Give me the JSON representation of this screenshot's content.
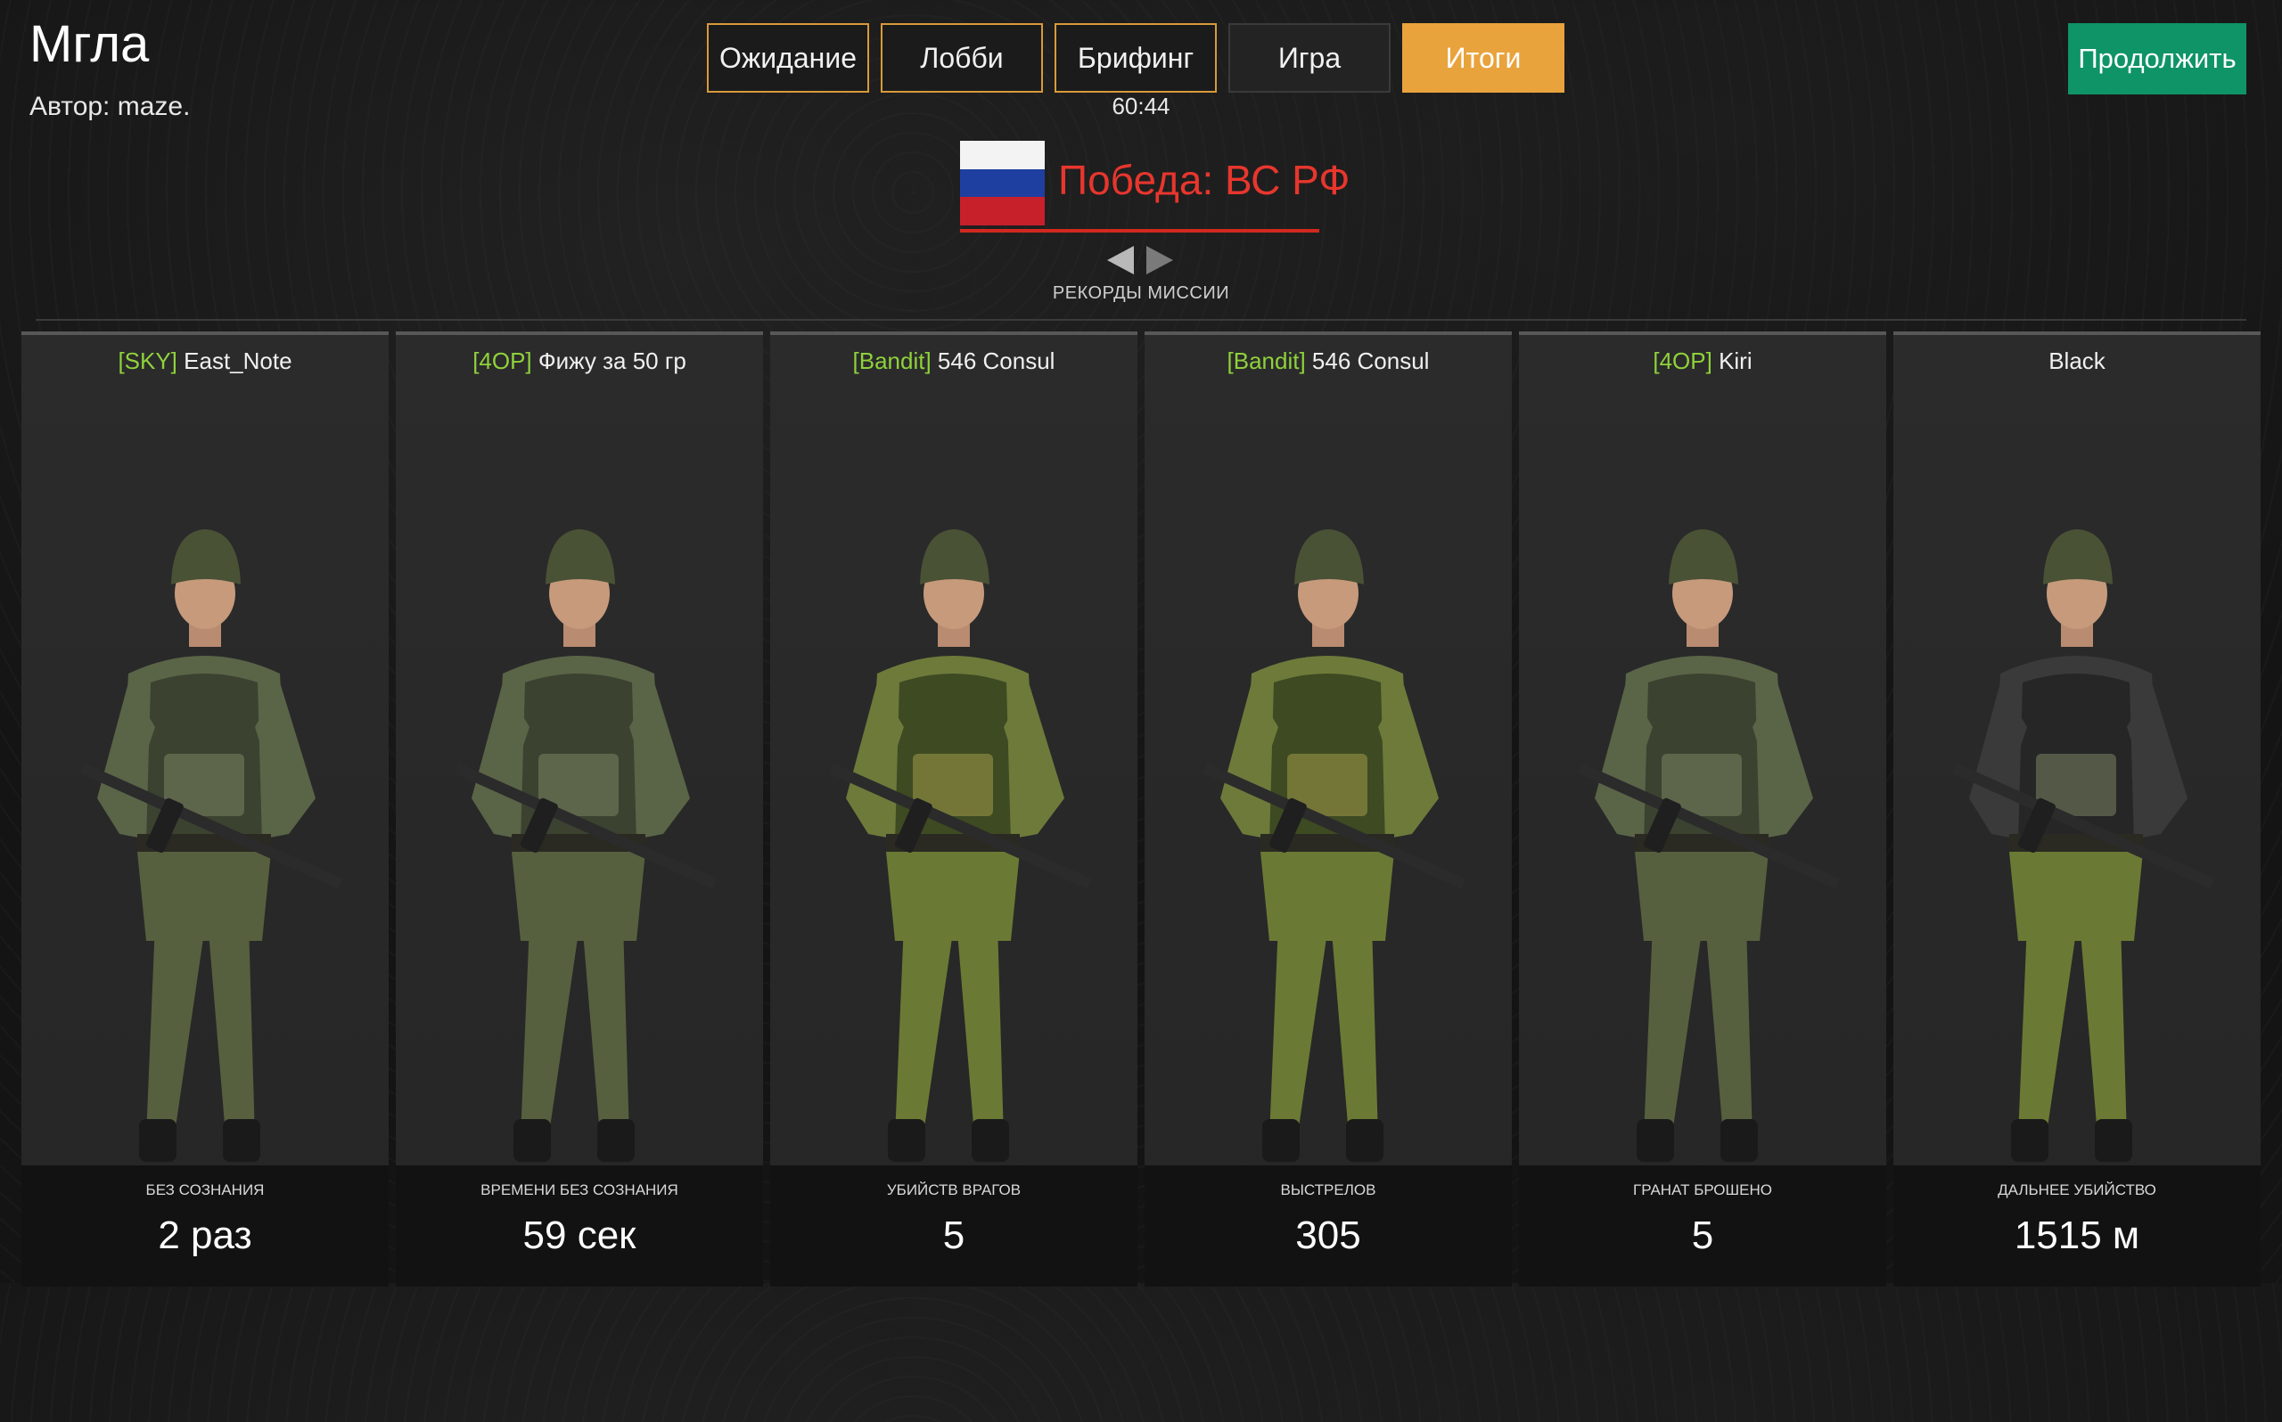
{
  "mission": {
    "title": "Мгла",
    "author": "Автор: maze."
  },
  "tabs": [
    {
      "label": "Ожидание",
      "state": "outlined"
    },
    {
      "label": "Лобби",
      "state": "outlined"
    },
    {
      "label": "Брифинг",
      "state": "outlined"
    },
    {
      "label": "Игра",
      "state": "plain"
    },
    {
      "label": "Итоги",
      "state": "active"
    }
  ],
  "timer": "60:44",
  "continue_label": "Продолжить",
  "victory": {
    "text": "Победа: ВС РФ",
    "flag": "russia-flag"
  },
  "records_label": "РЕКОРДЫ МИССИИ",
  "colors": {
    "accent": "#e9a33d",
    "continue": "#0f9467",
    "victory": "#e8362d",
    "tag": "#8fd23b"
  },
  "cards": [
    {
      "tag": "[SKY]",
      "name": " East_Note",
      "stat_label": "БЕЗ СОЗНАНИЯ",
      "stat_value": "2 раз",
      "uniform": "digital"
    },
    {
      "tag": "[4OP]",
      "name": " Фижу за 50 гр",
      "stat_label": "ВРЕМЕНИ БЕЗ СОЗНАНИЯ",
      "stat_value": "59 сек",
      "uniform": "digital"
    },
    {
      "tag": "[Bandit]",
      "name": " 546 Consul",
      "stat_label": "УБИЙСТВ ВРАГОВ",
      "stat_value": "5",
      "uniform": "woodland"
    },
    {
      "tag": "[Bandit]",
      "name": " 546 Consul",
      "stat_label": "ВЫСТРЕЛОВ",
      "stat_value": "305",
      "uniform": "woodland"
    },
    {
      "tag": "[4OP]",
      "name": " Kiri",
      "stat_label": "ГРАНАТ БРОШЕНО",
      "stat_value": "5",
      "uniform": "digital"
    },
    {
      "tag": "",
      "name": "Black",
      "stat_label": "ДАЛЬНЕЕ УБИЙСТВО",
      "stat_value": "1515 м",
      "uniform": "sweater"
    }
  ]
}
